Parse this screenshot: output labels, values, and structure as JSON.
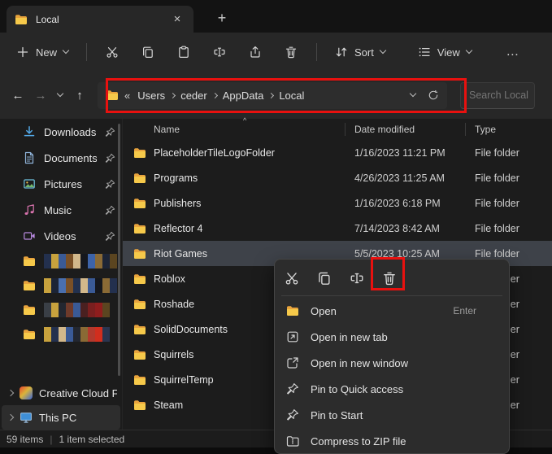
{
  "colors": {
    "accent_red": "#e8110f",
    "folder_yellow": "#f6c94a",
    "selection_bg": "#3e4249",
    "chrome_bg": "#272727",
    "titlebar_bg": "#131313",
    "content_bg": "#1c1c1c",
    "menu_bg": "#2c2c2c"
  },
  "titlebar": {
    "tab_title": "Local",
    "close_glyph": "×",
    "new_tab_glyph": "+"
  },
  "toolbar": {
    "new_label": "New",
    "sort_label": "Sort",
    "view_label": "View",
    "more_glyph": "…",
    "icons": [
      "cut-icon",
      "copy-icon",
      "paste-icon",
      "rename-icon",
      "share-icon",
      "delete-icon"
    ]
  },
  "navigation": {
    "back_glyph": "←",
    "forward_glyph": "→",
    "up_glyph": "↑"
  },
  "addressbar": {
    "overflow_glyph": "«",
    "segments": [
      "Users",
      "ceder",
      "AppData",
      "Local"
    ]
  },
  "search": {
    "placeholder": "Search Local"
  },
  "sidebar": {
    "items": [
      {
        "label": "Downloads",
        "icon": "downloads-icon",
        "pinned": true
      },
      {
        "label": "Documents",
        "icon": "documents-icon",
        "pinned": true
      },
      {
        "label": "Pictures",
        "icon": "pictures-icon",
        "pinned": true
      },
      {
        "label": "Music",
        "icon": "music-icon",
        "pinned": true
      },
      {
        "label": "Videos",
        "icon": "videos-icon",
        "pinned": true
      }
    ],
    "redacted_folders": [
      {
        "blocks": [
          "#23304e",
          "#c8a23d",
          "#3a5a96",
          "#7a5026",
          "#d2b88b",
          "#15171d",
          "#3d63a8",
          "#8a6a35",
          "#1c2436",
          "#5b4520"
        ]
      },
      {
        "blocks": [
          "#c8a23d",
          "#1c2436",
          "#4a6fae",
          "#7a5026",
          "#22314f",
          "#d2b88b",
          "#3a5a96",
          "#15171d",
          "#8a6a35",
          "#23304e"
        ]
      },
      {
        "blocks": [
          "#3a3f46",
          "#c8a23d",
          "#232730",
          "#6e3a2a",
          "#3a5a96",
          "#4a2020",
          "#7a1f1f",
          "#8f1d1d",
          "#5b4520"
        ]
      },
      {
        "blocks": [
          "#c8a23d",
          "#23304e",
          "#d2b88b",
          "#3a5a96",
          "#232730",
          "#8a6a35",
          "#b3392d",
          "#d12e1e",
          "#2a3550"
        ]
      }
    ],
    "drives": [
      {
        "label": "Creative Cloud F",
        "icon": "creative-cloud-icon",
        "expandable": true,
        "highlighted": false
      },
      {
        "label": "This PC",
        "icon": "this-pc-icon",
        "expandable": true,
        "highlighted": true
      }
    ]
  },
  "filelist": {
    "columns": [
      "Name",
      "Date modified",
      "Type"
    ],
    "sort_indicator": "^",
    "rows": [
      {
        "name": "PlaceholderTileLogoFolder",
        "date": "1/16/2023 11:21 PM",
        "type": "File folder",
        "selected": false
      },
      {
        "name": "Programs",
        "date": "4/26/2023 11:25 AM",
        "type": "File folder",
        "selected": false
      },
      {
        "name": "Publishers",
        "date": "1/16/2023 6:18 PM",
        "type": "File folder",
        "selected": false
      },
      {
        "name": "Reflector 4",
        "date": "7/14/2023 8:42 AM",
        "type": "File folder",
        "selected": false
      },
      {
        "name": "Riot Games",
        "date": "5/5/2023 10:25 AM",
        "type": "File folder",
        "selected": true
      },
      {
        "name": "Roblox",
        "date": "",
        "type": "File folder",
        "selected": false
      },
      {
        "name": "Roshade",
        "date": "",
        "type": "File folder",
        "selected": false
      },
      {
        "name": "SolidDocuments",
        "date": "",
        "type": "File folder",
        "selected": false
      },
      {
        "name": "Squirrels",
        "date": "",
        "type": "File folder",
        "selected": false
      },
      {
        "name": "SquirrelTemp",
        "date": "",
        "type": "File folder",
        "selected": false
      },
      {
        "name": "Steam",
        "date": "",
        "type": "File folder",
        "selected": false
      }
    ]
  },
  "context_menu": {
    "quick_actions": [
      "cut-icon",
      "copy-icon",
      "rename-icon",
      "delete-icon"
    ],
    "items": [
      {
        "label": "Open",
        "icon": "open-folder-icon",
        "shortcut": "Enter"
      },
      {
        "label": "Open in new tab",
        "icon": "open-new-tab-icon",
        "shortcut": ""
      },
      {
        "label": "Open in new window",
        "icon": "open-new-window-icon",
        "shortcut": ""
      },
      {
        "label": "Pin to Quick access",
        "icon": "pin-icon",
        "shortcut": ""
      },
      {
        "label": "Pin to Start",
        "icon": "pin-icon",
        "shortcut": ""
      },
      {
        "label": "Compress to ZIP file",
        "icon": "zip-icon",
        "shortcut": ""
      }
    ]
  },
  "statusbar": {
    "item_count": "59 items",
    "divider": "|",
    "selection_status": "1 item selected"
  }
}
